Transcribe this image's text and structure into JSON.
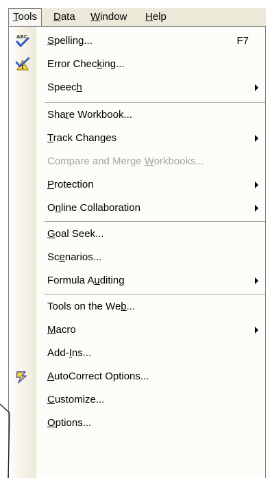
{
  "menubar": {
    "tools": {
      "pre": "",
      "u": "T",
      "post": "ools"
    },
    "data": {
      "pre": "",
      "u": "D",
      "post": "ata"
    },
    "window": {
      "pre": "",
      "u": "W",
      "post": "indow"
    },
    "help": {
      "pre": "",
      "u": "H",
      "post": "elp"
    }
  },
  "menu": {
    "spelling": {
      "pre": "",
      "u": "S",
      "post": "pelling...",
      "shortcut": "F7",
      "icon": "spelling-abc-check-icon"
    },
    "error_checking": {
      "pre": "Error Chec",
      "u": "k",
      "post": "ing...",
      "icon": "error-checking-icon"
    },
    "speech": {
      "pre": "Speec",
      "u": "h",
      "post": ""
    },
    "share_workbook": {
      "pre": "Sha",
      "u": "r",
      "post": "e Workbook..."
    },
    "track_changes": {
      "pre": "",
      "u": "T",
      "post": "rack Changes"
    },
    "compare_merge": {
      "pre": "Compare and Merge ",
      "u": "W",
      "post": "orkbooks..."
    },
    "protection": {
      "pre": "",
      "u": "P",
      "post": "rotection"
    },
    "online_collab": {
      "pre": "O",
      "u": "n",
      "post": "line Collaboration"
    },
    "goal_seek": {
      "pre": "",
      "u": "G",
      "post": "oal Seek..."
    },
    "scenarios": {
      "pre": "Sc",
      "u": "e",
      "post": "narios..."
    },
    "formula_auditing": {
      "pre": "Formula A",
      "u": "u",
      "post": "diting"
    },
    "tools_web": {
      "pre": "Tools on the We",
      "u": "b",
      "post": "..."
    },
    "macro": {
      "pre": "",
      "u": "M",
      "post": "acro"
    },
    "addins": {
      "pre": "Add-",
      "u": "I",
      "post": "ns..."
    },
    "autocorrect": {
      "pre": "",
      "u": "A",
      "post": "utoCorrect Options...",
      "icon": "autocorrect-lightning-icon"
    },
    "customize": {
      "pre": "",
      "u": "C",
      "post": "ustomize..."
    },
    "options": {
      "pre": "",
      "u": "O",
      "post": "ptions..."
    }
  },
  "colors": {
    "menubar_bg": "#ece9d8",
    "menu_bg": "#fcfcf9",
    "disabled_text": "#a7a69b",
    "separator": "#a6a69a",
    "callout_line": "#1a1a1a"
  }
}
